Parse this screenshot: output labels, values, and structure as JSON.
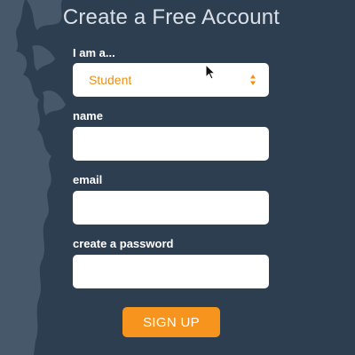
{
  "form": {
    "title": "Create a Free Account",
    "role_label": "I am a...",
    "role_selected": "Student",
    "name_label": "name",
    "name_value": "",
    "email_label": "email",
    "email_value": "",
    "password_label": "create a password",
    "password_value": "",
    "submit_label": "SIGN UP"
  },
  "icons": {
    "select": "updown-arrows-icon",
    "pointer": "mouse-cursor-icon"
  },
  "colors": {
    "background": "#2e3e51",
    "accent": "#f7941d",
    "selected_text": "#f0900f",
    "map_shape": "#4a5b6e"
  }
}
